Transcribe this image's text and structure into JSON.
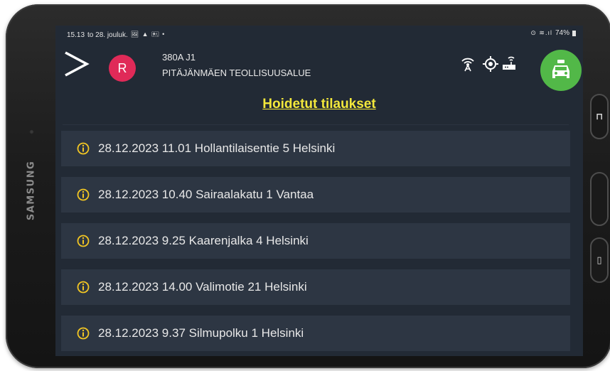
{
  "device": {
    "brand": "SAMSUNG"
  },
  "status_bar": {
    "time": "15.13",
    "date": "to 28. jouluk.",
    "left_icons": "🖼 ▲ 🖭 •",
    "right_icons": "⊙ ≋.ıl",
    "battery": "74%"
  },
  "header": {
    "avatar_letter": "R",
    "route_code": "380A J1",
    "area": "PITÄJÄNMÄEN TEOLLISUUSALUE"
  },
  "page": {
    "title": "Hoidetut tilaukset"
  },
  "orders": [
    {
      "text": "28.12.2023 11.01 Hollantilaisentie 5 Helsinki"
    },
    {
      "text": "28.12.2023 10.40 Sairaalakatu 1 Vantaa"
    },
    {
      "text": "28.12.2023 9.25 Kaarenjalka 4 Helsinki"
    },
    {
      "text": "28.12.2023 14.00 Valimotie 21 Helsinki"
    },
    {
      "text": "28.12.2023 9.37 Silmupolku 1 Helsinki"
    }
  ],
  "colors": {
    "screen_bg": "#222a35",
    "row_bg": "#2d3643",
    "title": "#f3e83b",
    "info_icon": "#f2c623",
    "avatar": "#e02a58",
    "taxi_button": "#52b848"
  }
}
